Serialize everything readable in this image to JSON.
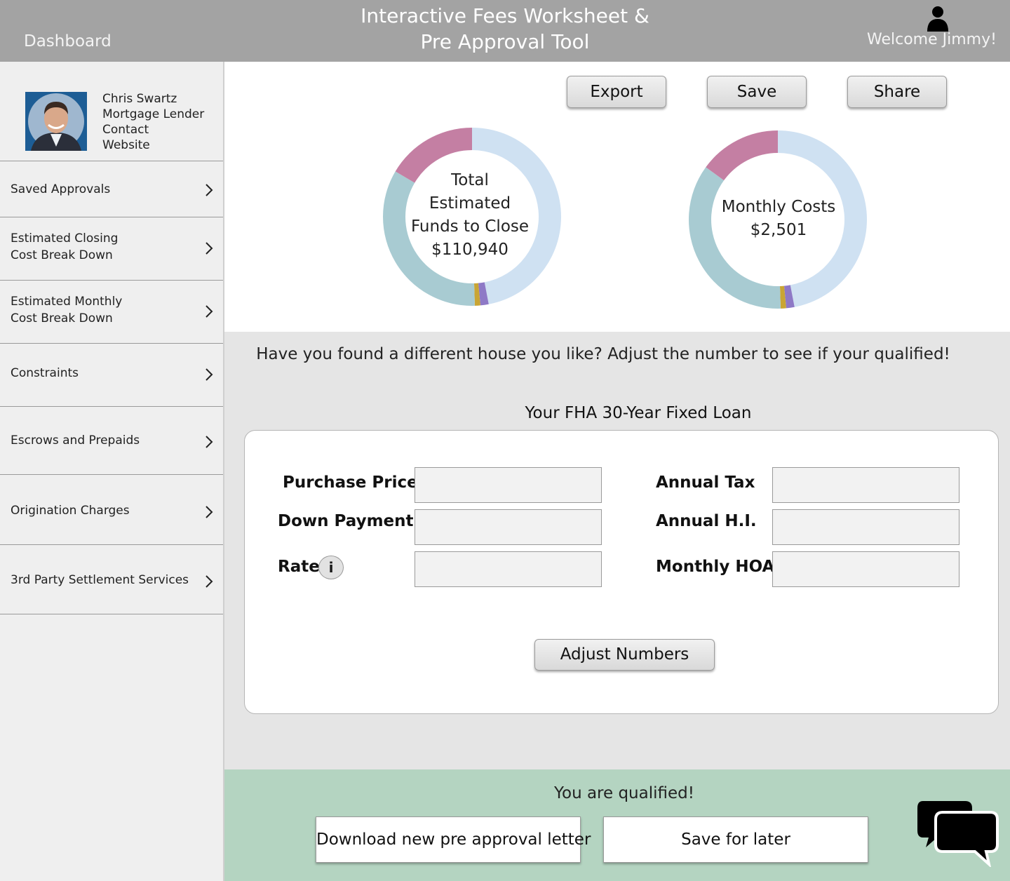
{
  "header": {
    "dashboard_label": "Dashboard",
    "title_line1": "Interactive Fees Worksheet &",
    "title_line2": "Pre Approval Tool",
    "welcome": "Welcome Jimmy!",
    "user_icon": "user-icon"
  },
  "profile": {
    "name": "Chris Swartz",
    "role": "Mortgage Lender",
    "contact": "Contact",
    "website": "Website"
  },
  "sidebar": {
    "items": [
      {
        "label": "Saved Approvals"
      },
      {
        "label": "Estimated Closing\nCost Break Down"
      },
      {
        "label": "Estimated Monthly\nCost Break Down"
      },
      {
        "label": "Constraints"
      },
      {
        "label": "Escrows and Prepaids"
      },
      {
        "label": "Origination Charges"
      },
      {
        "label": "3rd Party Settlement Services"
      }
    ]
  },
  "toolbar": {
    "export": "Export",
    "save": "Save",
    "share": "Share"
  },
  "chart_data": [
    {
      "type": "pie",
      "center_label_lines": [
        "Total",
        "Estimated",
        "Funds to Close"
      ],
      "center_value": "$110,940",
      "slices_fraction": [
        0.47,
        0.015,
        0.01,
        0.34,
        0.165
      ],
      "colors": [
        "#cfe1f2",
        "#8e79c6",
        "#c9a534",
        "#a8cbd2",
        "#c47fa3"
      ]
    },
    {
      "type": "pie",
      "center_label_lines": [
        "Monthly Costs"
      ],
      "center_value": "$2,501",
      "slices_fraction": [
        0.47,
        0.015,
        0.01,
        0.355,
        0.15
      ],
      "colors": [
        "#cfe1f2",
        "#8e79c6",
        "#c9a534",
        "#a8cbd2",
        "#c47fa3"
      ]
    }
  ],
  "main": {
    "prompt": "Have you found a different house you like? Adjust the number to see if your qualified!",
    "loan_title": "Your FHA 30-Year Fixed Loan",
    "labels": {
      "purchase_price": "Purchase Price",
      "down_payment": "Down Payment",
      "rate": "Rate",
      "rate_info": "i",
      "annual_tax": "Annual Tax",
      "annual_hi": "Annual H.I.",
      "monthly_hoa": "Monthly HOA"
    },
    "values": {
      "purchase_price": "",
      "down_payment": "",
      "rate": "",
      "annual_tax": "",
      "annual_hi": "",
      "monthly_hoa": ""
    },
    "adjust_button": "Adjust Numbers"
  },
  "qualification": {
    "status": "You are qualified!",
    "download_button": "Download new pre approval letter",
    "save_later_button": "Save for later",
    "chat_icon": "chat-bubbles-icon"
  }
}
